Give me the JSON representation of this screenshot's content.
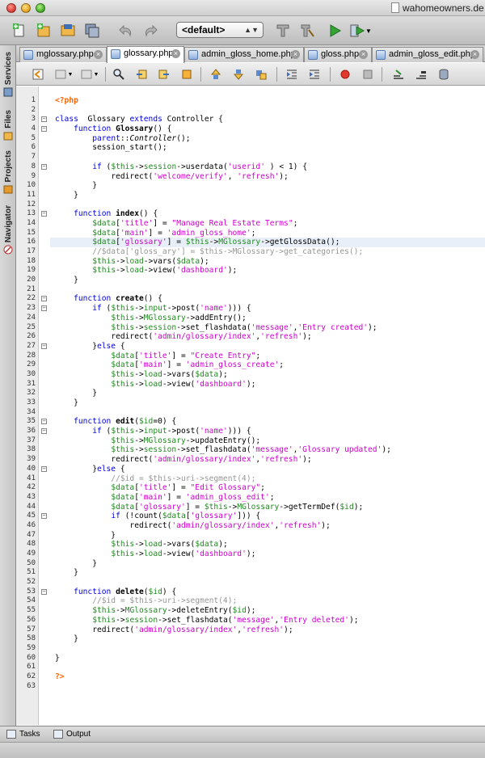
{
  "window": {
    "title": "wahomeowners.de"
  },
  "toolbar": {
    "config_value": "<default>",
    "buttons": [
      "new-file-icon",
      "new-project-icon",
      "open-project-icon",
      "save-all-icon",
      "undo-icon",
      "redo-icon",
      "build-icon",
      "clean-build-icon",
      "run-icon",
      "debug-icon"
    ]
  },
  "side_tabs": {
    "services": "Services",
    "files": "Files",
    "projects": "Projects",
    "navigator": "Navigator"
  },
  "editor_tabs": [
    {
      "label": "mglossary.php",
      "active": false
    },
    {
      "label": "glossary.php",
      "active": true
    },
    {
      "label": "admin_gloss_home.php",
      "active": false
    },
    {
      "label": "gloss.php",
      "active": false
    },
    {
      "label": "admin_gloss_edit.php",
      "active": false
    }
  ],
  "highlighted_line": 16,
  "code_lines": [
    [
      [
        "tg",
        "<?php"
      ]
    ],
    [],
    [
      [
        "kw",
        "class"
      ],
      [
        "",
        "  Glossary "
      ],
      [
        "kw",
        "extends"
      ],
      [
        "",
        " Controller {"
      ]
    ],
    [
      [
        "",
        "    "
      ],
      [
        "kw",
        "function"
      ],
      [
        "",
        " "
      ],
      [
        "b",
        "Glossary"
      ],
      [
        "",
        "() {"
      ]
    ],
    [
      [
        "",
        "        "
      ],
      [
        "kw",
        "parent"
      ],
      [
        "",
        "::"
      ],
      [
        "it",
        "Controller"
      ],
      [
        "",
        "();"
      ]
    ],
    [
      [
        "",
        "        session_start();"
      ]
    ],
    [],
    [
      [
        "",
        "        "
      ],
      [
        "kw",
        "if"
      ],
      [
        "",
        " ("
      ],
      [
        "vr",
        "$this"
      ],
      [
        "",
        "->"
      ],
      [
        "vr",
        "session"
      ],
      [
        "",
        "->userdata("
      ],
      [
        "st",
        "'userid'"
      ],
      [
        "",
        " ) < 1) {"
      ]
    ],
    [
      [
        "",
        "            redirect("
      ],
      [
        "st",
        "'welcome/verify'"
      ],
      [
        "",
        ", "
      ],
      [
        "st",
        "'refresh'"
      ],
      [
        "",
        ");"
      ]
    ],
    [
      [
        "",
        "        }"
      ]
    ],
    [
      [
        "",
        "    }"
      ]
    ],
    [],
    [
      [
        "",
        "    "
      ],
      [
        "kw",
        "function"
      ],
      [
        "",
        " "
      ],
      [
        "b",
        "index"
      ],
      [
        "",
        "() {"
      ]
    ],
    [
      [
        "",
        "        "
      ],
      [
        "vr",
        "$data"
      ],
      [
        "",
        "["
      ],
      [
        "st",
        "'title'"
      ],
      [
        "",
        "] = "
      ],
      [
        "st",
        "\"Manage Real Estate Terms\""
      ],
      [
        "",
        ";"
      ]
    ],
    [
      [
        "",
        "        "
      ],
      [
        "vr",
        "$data"
      ],
      [
        "",
        "["
      ],
      [
        "st",
        "'main'"
      ],
      [
        "",
        "] = "
      ],
      [
        "st",
        "'admin_gloss_home'"
      ],
      [
        "",
        ";"
      ]
    ],
    [
      [
        "",
        "        "
      ],
      [
        "vr",
        "$data"
      ],
      [
        "",
        "["
      ],
      [
        "st",
        "'glossary'"
      ],
      [
        "",
        "] = "
      ],
      [
        "vr",
        "$this"
      ],
      [
        "",
        "->"
      ],
      [
        "vr",
        "MGlossary"
      ],
      [
        "",
        "->getGlossData();"
      ]
    ],
    [
      [
        "cm",
        "        //$data['gloss_ary'] = $this->MGlossary->get_categories();"
      ]
    ],
    [
      [
        "",
        "        "
      ],
      [
        "vr",
        "$this"
      ],
      [
        "",
        "->"
      ],
      [
        "vr",
        "load"
      ],
      [
        "",
        "->vars("
      ],
      [
        "vr",
        "$data"
      ],
      [
        "",
        ");"
      ]
    ],
    [
      [
        "",
        "        "
      ],
      [
        "vr",
        "$this"
      ],
      [
        "",
        "->"
      ],
      [
        "vr",
        "load"
      ],
      [
        "",
        "->view("
      ],
      [
        "st",
        "'dashboard'"
      ],
      [
        "",
        ");"
      ]
    ],
    [
      [
        "",
        "    }"
      ]
    ],
    [],
    [
      [
        "",
        "    "
      ],
      [
        "kw",
        "function"
      ],
      [
        "",
        " "
      ],
      [
        "b",
        "create"
      ],
      [
        "",
        "() {"
      ]
    ],
    [
      [
        "",
        "        "
      ],
      [
        "kw",
        "if"
      ],
      [
        "",
        " ("
      ],
      [
        "vr",
        "$this"
      ],
      [
        "",
        "->"
      ],
      [
        "vr",
        "input"
      ],
      [
        "",
        "->post("
      ],
      [
        "st",
        "'name'"
      ],
      [
        "",
        "))) {"
      ]
    ],
    [
      [
        "",
        "            "
      ],
      [
        "vr",
        "$this"
      ],
      [
        "",
        "->"
      ],
      [
        "vr",
        "MGlossary"
      ],
      [
        "",
        "->addEntry();"
      ]
    ],
    [
      [
        "",
        "            "
      ],
      [
        "vr",
        "$this"
      ],
      [
        "",
        "->"
      ],
      [
        "vr",
        "session"
      ],
      [
        "",
        "->set_flashdata("
      ],
      [
        "st",
        "'message'"
      ],
      [
        "",
        ","
      ],
      [
        "st",
        "'Entry created'"
      ],
      [
        "",
        ");"
      ]
    ],
    [
      [
        "",
        "            redirect("
      ],
      [
        "st",
        "'admin/glossary/index'"
      ],
      [
        "",
        ","
      ],
      [
        "st",
        "'refresh'"
      ],
      [
        "",
        ");"
      ]
    ],
    [
      [
        "",
        "        }"
      ],
      [
        "kw",
        "else"
      ],
      [
        "",
        " {"
      ]
    ],
    [
      [
        "",
        "            "
      ],
      [
        "vr",
        "$data"
      ],
      [
        "",
        "["
      ],
      [
        "st",
        "'title'"
      ],
      [
        "",
        "] = "
      ],
      [
        "st",
        "\"Create Entry\""
      ],
      [
        "",
        ";"
      ]
    ],
    [
      [
        "",
        "            "
      ],
      [
        "vr",
        "$data"
      ],
      [
        "",
        "["
      ],
      [
        "st",
        "'main'"
      ],
      [
        "",
        "] = "
      ],
      [
        "st",
        "'admin_gloss_create'"
      ],
      [
        "",
        ";"
      ]
    ],
    [
      [
        "",
        "            "
      ],
      [
        "vr",
        "$this"
      ],
      [
        "",
        "->"
      ],
      [
        "vr",
        "load"
      ],
      [
        "",
        "->vars("
      ],
      [
        "vr",
        "$data"
      ],
      [
        "",
        ");"
      ]
    ],
    [
      [
        "",
        "            "
      ],
      [
        "vr",
        "$this"
      ],
      [
        "",
        "->"
      ],
      [
        "vr",
        "load"
      ],
      [
        "",
        "->view("
      ],
      [
        "st",
        "'dashboard'"
      ],
      [
        "",
        ");"
      ]
    ],
    [
      [
        "",
        "        }"
      ]
    ],
    [
      [
        "",
        "    }"
      ]
    ],
    [],
    [
      [
        "",
        "    "
      ],
      [
        "kw",
        "function"
      ],
      [
        "",
        " "
      ],
      [
        "b",
        "edit"
      ],
      [
        "",
        "("
      ],
      [
        "vr",
        "$id"
      ],
      [
        "",
        "=0) {"
      ]
    ],
    [
      [
        "",
        "        "
      ],
      [
        "kw",
        "if"
      ],
      [
        "",
        " ("
      ],
      [
        "vr",
        "$this"
      ],
      [
        "",
        "->"
      ],
      [
        "vr",
        "input"
      ],
      [
        "",
        "->post("
      ],
      [
        "st",
        "'name'"
      ],
      [
        "",
        "))) {"
      ]
    ],
    [
      [
        "",
        "            "
      ],
      [
        "vr",
        "$this"
      ],
      [
        "",
        "->"
      ],
      [
        "vr",
        "MGlossary"
      ],
      [
        "",
        "->updateEntry();"
      ]
    ],
    [
      [
        "",
        "            "
      ],
      [
        "vr",
        "$this"
      ],
      [
        "",
        "->"
      ],
      [
        "vr",
        "session"
      ],
      [
        "",
        "->set_flashdata("
      ],
      [
        "st",
        "'message'"
      ],
      [
        "",
        ","
      ],
      [
        "st",
        "'Glossary updated'"
      ],
      [
        "",
        ");"
      ]
    ],
    [
      [
        "",
        "            redirect("
      ],
      [
        "st",
        "'admin/glossary/index'"
      ],
      [
        "",
        ","
      ],
      [
        "st",
        "'refresh'"
      ],
      [
        "",
        ");"
      ]
    ],
    [
      [
        "",
        "        }"
      ],
      [
        "kw",
        "else"
      ],
      [
        "",
        " {"
      ]
    ],
    [
      [
        "cm",
        "            //$id = $this->uri->segment(4);"
      ]
    ],
    [
      [
        "",
        "            "
      ],
      [
        "vr",
        "$data"
      ],
      [
        "",
        "["
      ],
      [
        "st",
        "'title'"
      ],
      [
        "",
        "] = "
      ],
      [
        "st",
        "\"Edit Glossary\""
      ],
      [
        "",
        ";"
      ]
    ],
    [
      [
        "",
        "            "
      ],
      [
        "vr",
        "$data"
      ],
      [
        "",
        "["
      ],
      [
        "st",
        "'main'"
      ],
      [
        "",
        "] = "
      ],
      [
        "st",
        "'admin_gloss_edit'"
      ],
      [
        "",
        ";"
      ]
    ],
    [
      [
        "",
        "            "
      ],
      [
        "vr",
        "$data"
      ],
      [
        "",
        "["
      ],
      [
        "st",
        "'glossary'"
      ],
      [
        "",
        "] = "
      ],
      [
        "vr",
        "$this"
      ],
      [
        "",
        "->"
      ],
      [
        "vr",
        "MGlossary"
      ],
      [
        "",
        "->getTermDef("
      ],
      [
        "vr",
        "$id"
      ],
      [
        "",
        ");"
      ]
    ],
    [
      [
        "",
        "            "
      ],
      [
        "kw",
        "if"
      ],
      [
        "",
        " (!count("
      ],
      [
        "vr",
        "$data"
      ],
      [
        "",
        "["
      ],
      [
        "st",
        "'glossary'"
      ],
      [
        "",
        "])) {"
      ]
    ],
    [
      [
        "",
        "                redirect("
      ],
      [
        "st",
        "'admin/glossary/index'"
      ],
      [
        "",
        ","
      ],
      [
        "st",
        "'refresh'"
      ],
      [
        "",
        ");"
      ]
    ],
    [
      [
        "",
        "            }"
      ]
    ],
    [
      [
        "",
        "            "
      ],
      [
        "vr",
        "$this"
      ],
      [
        "",
        "->"
      ],
      [
        "vr",
        "load"
      ],
      [
        "",
        "->vars("
      ],
      [
        "vr",
        "$data"
      ],
      [
        "",
        ");"
      ]
    ],
    [
      [
        "",
        "            "
      ],
      [
        "vr",
        "$this"
      ],
      [
        "",
        "->"
      ],
      [
        "vr",
        "load"
      ],
      [
        "",
        "->view("
      ],
      [
        "st",
        "'dashboard'"
      ],
      [
        "",
        ");"
      ]
    ],
    [
      [
        "",
        "        }"
      ]
    ],
    [
      [
        "",
        "    }"
      ]
    ],
    [],
    [
      [
        "",
        "    "
      ],
      [
        "kw",
        "function"
      ],
      [
        "",
        " "
      ],
      [
        "b",
        "delete"
      ],
      [
        "",
        "("
      ],
      [
        "vr",
        "$id"
      ],
      [
        "",
        ") {"
      ]
    ],
    [
      [
        "cm",
        "        //$id = $this->uri->segment(4);"
      ]
    ],
    [
      [
        "",
        "        "
      ],
      [
        "vr",
        "$this"
      ],
      [
        "",
        "->"
      ],
      [
        "vr",
        "MGlossary"
      ],
      [
        "",
        "->deleteEntry("
      ],
      [
        "vr",
        "$id"
      ],
      [
        "",
        ");"
      ]
    ],
    [
      [
        "",
        "        "
      ],
      [
        "vr",
        "$this"
      ],
      [
        "",
        "->"
      ],
      [
        "vr",
        "session"
      ],
      [
        "",
        "->set_flashdata("
      ],
      [
        "st",
        "'message'"
      ],
      [
        "",
        ","
      ],
      [
        "st",
        "'Entry deleted'"
      ],
      [
        "",
        ");"
      ]
    ],
    [
      [
        "",
        "        redirect("
      ],
      [
        "st",
        "'admin/glossary/index'"
      ],
      [
        "",
        ","
      ],
      [
        "st",
        "'refresh'"
      ],
      [
        "",
        ");"
      ]
    ],
    [
      [
        "",
        "    }"
      ]
    ],
    [],
    [
      [
        "",
        "}"
      ]
    ],
    [],
    [
      [
        "tg",
        "?>"
      ]
    ],
    []
  ],
  "fold_lines": [
    3,
    4,
    8,
    13,
    22,
    23,
    27,
    35,
    36,
    40,
    45,
    53
  ],
  "bottom_tabs": {
    "tasks": "Tasks",
    "output": "Output"
  },
  "colors": {
    "keyword": "#0000e6",
    "variable": "#208a20",
    "string": "#ce00ce",
    "comment": "#969696",
    "php_tag": "#ff6400",
    "highlight_line": "#e9eff8"
  }
}
